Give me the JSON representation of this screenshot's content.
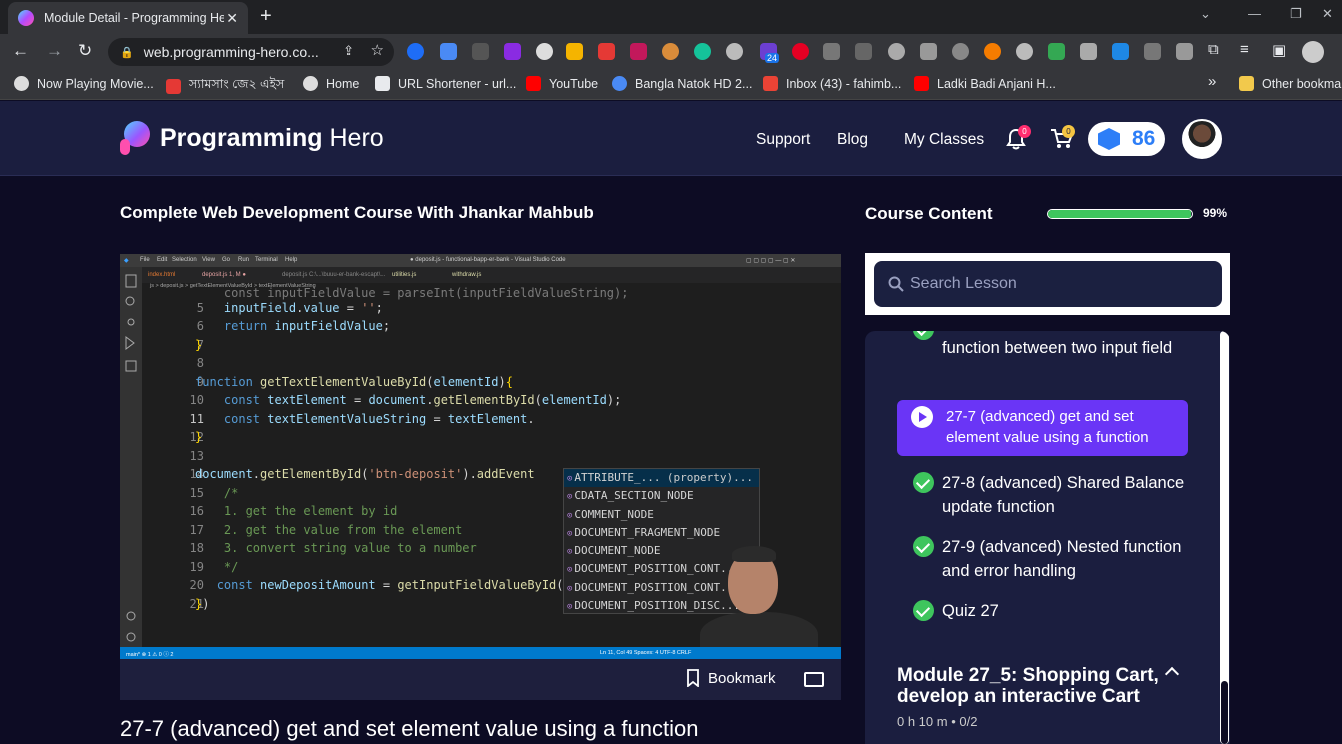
{
  "browser": {
    "tab_title": "Module Detail - Programming Hero",
    "url": "web.programming-hero.co...",
    "bookmarks": [
      {
        "label": "Now Playing Movie..."
      },
      {
        "label": "স্যামসাং জে২ এইস"
      },
      {
        "label": "Home"
      },
      {
        "label": "URL Shortener - url..."
      },
      {
        "label": "YouTube"
      },
      {
        "label": "Bangla Natok HD 2..."
      },
      {
        "label": "Inbox (43) - fahimb..."
      },
      {
        "label": "Ladki Badi Anjani H..."
      }
    ],
    "more_bookmarks": "»",
    "other_bookmarks": "Other bookmarks",
    "extension_badge": "24"
  },
  "header": {
    "logo_bold": "Programming",
    "logo_light": "Hero",
    "nav": [
      "Support",
      "Blog",
      "My Classes"
    ],
    "notification_count": "0",
    "cart_count": "0",
    "gems": "86"
  },
  "main": {
    "course_title": "Complete Web Development Course With Jhankar Mahbub",
    "bookmark_label": "Bookmark",
    "lesson_title": "27-7 (advanced) get and set element value using a function"
  },
  "video": {
    "vscode_title": "● deposit.js - functional-bapp-er-bank - Visual Studio Code",
    "menu": [
      "File",
      "Edit",
      "Selection",
      "View",
      "Go",
      "Run",
      "Terminal",
      "Help"
    ],
    "tabs": [
      "index.html",
      "deposit.js 1, M ●",
      "deposit.js C:\\...\\buuu-er-bank-escapt\\...",
      "utilities.js",
      "withdraw.js"
    ],
    "breadcrumb": "js > deposit.js > getTextElementValueById > textElementValueString",
    "code_lines": [
      {
        "n": "",
        "t": "    const inputFieldValue = parseInt(inputFieldValueString);"
      },
      {
        "n": "5",
        "t": "    inputField.value = '';"
      },
      {
        "n": "6",
        "t": "    return inputFieldValue;"
      },
      {
        "n": "7",
        "t": "}"
      },
      {
        "n": "8",
        "t": ""
      },
      {
        "n": "9",
        "t": "function getTextElementValueById(elementId){"
      },
      {
        "n": "10",
        "t": "    const textElement = document.getElementById(elementId);"
      },
      {
        "n": "11",
        "t": "    const textElementValueString = textElement."
      },
      {
        "n": "12",
        "t": "}"
      },
      {
        "n": "13",
        "t": ""
      },
      {
        "n": "14",
        "t": "document.getElementById('btn-deposit').addEvent                  (){"
      },
      {
        "n": "15",
        "t": "    /*"
      },
      {
        "n": "16",
        "t": "    1. get the element by id"
      },
      {
        "n": "17",
        "t": "    2. get the value from the element"
      },
      {
        "n": "18",
        "t": "    3. convert string value to a number"
      },
      {
        "n": "19",
        "t": "    */"
      },
      {
        "n": "20",
        "t": "   const newDepositAmount = getInputFieldValueById('deposit-field');"
      },
      {
        "n": "21",
        "t": "})"
      }
    ],
    "suggestions": [
      "ATTRIBUTE_...",
      "CDATA_SECTION_NODE",
      "COMMENT_NODE",
      "DOCUMENT_FRAGMENT_NODE",
      "DOCUMENT_NODE",
      "DOCUMENT_POSITION_CONT...",
      "DOCUMENT_POSITION_CONT...",
      "DOCUMENT_POSITION_DISC..."
    ],
    "suggestion_hint": "(property)...",
    "status_left": "main*   ⊗ 1 ⚠ 0 ⓘ 2",
    "status_right": "Ln 11, Col 49   Spaces: 4   UTF-8   CRLF"
  },
  "sidebar": {
    "title": "Course Content",
    "progress_pct": 99,
    "progress_label": "99%",
    "search_placeholder": "Search Lesson",
    "partial_item": "function between two input field",
    "active_item": "27-7 (advanced) get and set element value using a function",
    "items": [
      "27-8 (advanced) Shared Balance update function",
      "27-9 (advanced) Nested function and error handling",
      "Quiz 27"
    ],
    "module_title": "Module 27_5: Shopping Cart, develop an interactive Cart",
    "module_meta": "0 h 10 m  •  0/2"
  },
  "colors": {
    "accent_purple": "#6a35f6",
    "success_green": "#3ec55d",
    "header_bg": "#1b1e3f",
    "page_bg": "#0d0c24",
    "gem_blue": "#2d7ef7"
  }
}
